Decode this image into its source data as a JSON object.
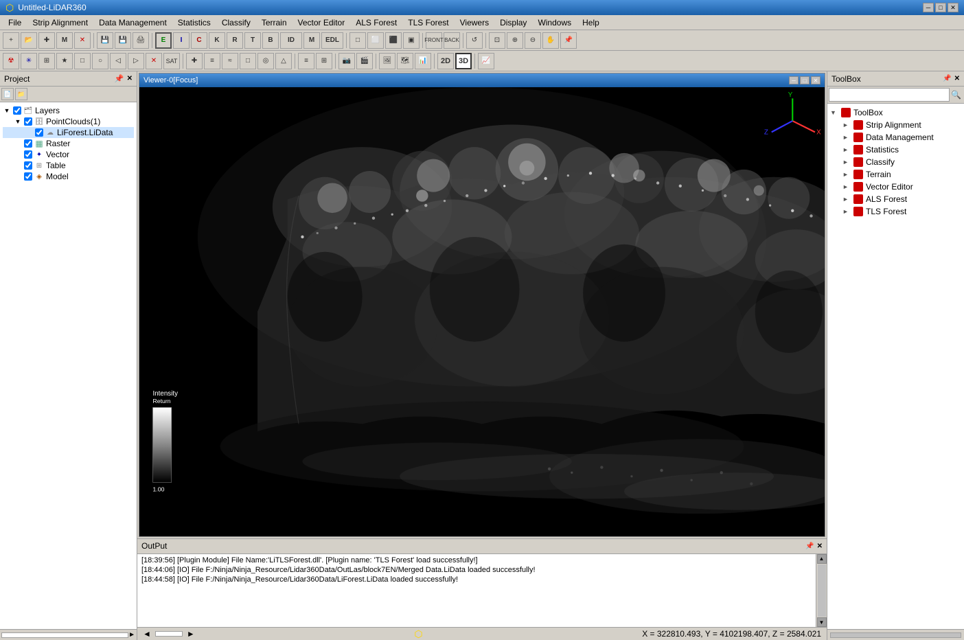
{
  "window": {
    "title": "Untitled-LiDAR360",
    "icon": "lidar-icon"
  },
  "titlebar": {
    "title": "Untitled-LiDAR360",
    "minimize": "─",
    "maximize": "□",
    "close": "✕"
  },
  "menu": {
    "items": [
      "File",
      "Strip Alignment",
      "Data Management",
      "Statistics",
      "Classify",
      "Terrain",
      "Vector Editor",
      "ALS Forest",
      "TLS Forest",
      "Viewers",
      "Display",
      "Windows",
      "Help"
    ]
  },
  "toolbar1": {
    "buttons": [
      "+",
      "📁",
      "+",
      "M",
      "✕",
      "🗄",
      "💾",
      "🖨",
      "E",
      "I",
      "C",
      "K",
      "R",
      "T",
      "B",
      "ID",
      "M",
      "EDL",
      "□",
      "□",
      "□",
      "□",
      "□",
      "□",
      "FRONT",
      "BACK",
      "◎",
      "↺",
      "⊡",
      "⊕",
      "⊖",
      "✋",
      "📌"
    ]
  },
  "toolbar2": {
    "buttons": [
      "☢",
      "✳",
      "⊡",
      "★",
      "□",
      "○",
      "◁",
      "▷",
      "✕",
      "SAT",
      "✚",
      "≡",
      "≈",
      "□",
      "◉",
      "△",
      "≡",
      "⊞",
      "🖼",
      "📷",
      "□",
      "□",
      "2D",
      "3D",
      "📈"
    ]
  },
  "project": {
    "title": "Project",
    "layers": {
      "label": "Layers",
      "children": [
        {
          "label": "PointClouds(1)",
          "children": [
            {
              "label": "LiForest.LiData",
              "checked": true
            }
          ]
        },
        {
          "label": "Raster",
          "checked": true
        },
        {
          "label": "Vector",
          "checked": true
        },
        {
          "label": "Table",
          "checked": true
        },
        {
          "label": "Model",
          "checked": true
        }
      ]
    }
  },
  "viewer": {
    "title": "Viewer-0[Focus]",
    "scale_labels": {
      "top": "Intensity",
      "return": "Return",
      "value_top": "",
      "value_bottom": "1.00"
    }
  },
  "toolbox": {
    "title": "ToolBox",
    "search_placeholder": "",
    "items": [
      {
        "label": "ToolBox",
        "expanded": true,
        "children": [
          {
            "label": "Strip Alignment"
          },
          {
            "label": "Data Management"
          },
          {
            "label": "Statistics"
          },
          {
            "label": "Classify"
          },
          {
            "label": "Terrain"
          },
          {
            "label": "Vector Editor"
          },
          {
            "label": "ALS Forest"
          },
          {
            "label": "TLS Forest"
          }
        ]
      }
    ]
  },
  "output": {
    "title": "OutPut",
    "lines": [
      "[18:39:56] [Plugin Module]    File Name:'LiTLSForest.dll'.  [Plugin name: 'TLS Forest' load successfully!]",
      "[18:44:06] [IO]    File F:/Ninja/Ninja_Resource/Lidar360Data/OutLas/block7EN/Merged Data.LiData loaded successfully!",
      "[18:44:58] [IO]    File F:/Ninja/Ninja_Resource/Lidar360Data/LiForest.LiData loaded successfully!"
    ]
  },
  "statusbar": {
    "coords": "X = 322810.493, Y = 4102198.407, Z = 2584.021",
    "scroll_left": "◄",
    "scroll_right": "►"
  }
}
